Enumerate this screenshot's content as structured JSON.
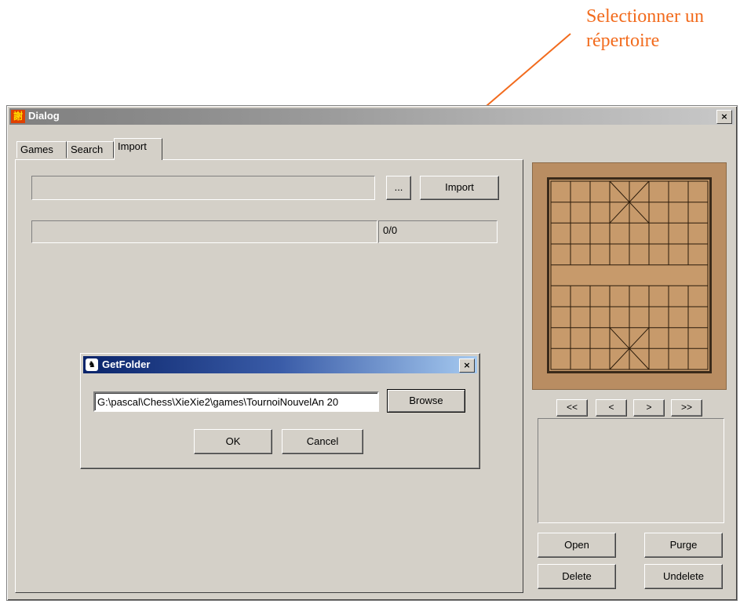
{
  "annotation": {
    "line1": "Selectionner un",
    "line2": "répertoire",
    "color": "#f26b1d"
  },
  "dialog": {
    "title": "Dialog",
    "close_label": "×",
    "tabs": [
      {
        "label": "Games",
        "active": false
      },
      {
        "label": "Search",
        "active": false
      },
      {
        "label": "Import",
        "active": true
      }
    ],
    "import": {
      "browse_label": "...",
      "import_label": "Import",
      "progress_text": "0/0"
    },
    "nav": {
      "first": "<<",
      "prev": "<",
      "next": ">",
      "last": ">>"
    },
    "buttons": {
      "open": "Open",
      "purge": "Purge",
      "delete": "Delete",
      "undelete": "Undelete"
    }
  },
  "getfolder": {
    "title": "GetFolder",
    "close_label": "×",
    "path_value": "G:\\pascal\\Chess\\XieXie2\\games\\TournoiNouvelAn 20",
    "browse_label": "Browse",
    "ok_label": "OK",
    "cancel_label": "Cancel",
    "title_color": "#0a246a"
  }
}
